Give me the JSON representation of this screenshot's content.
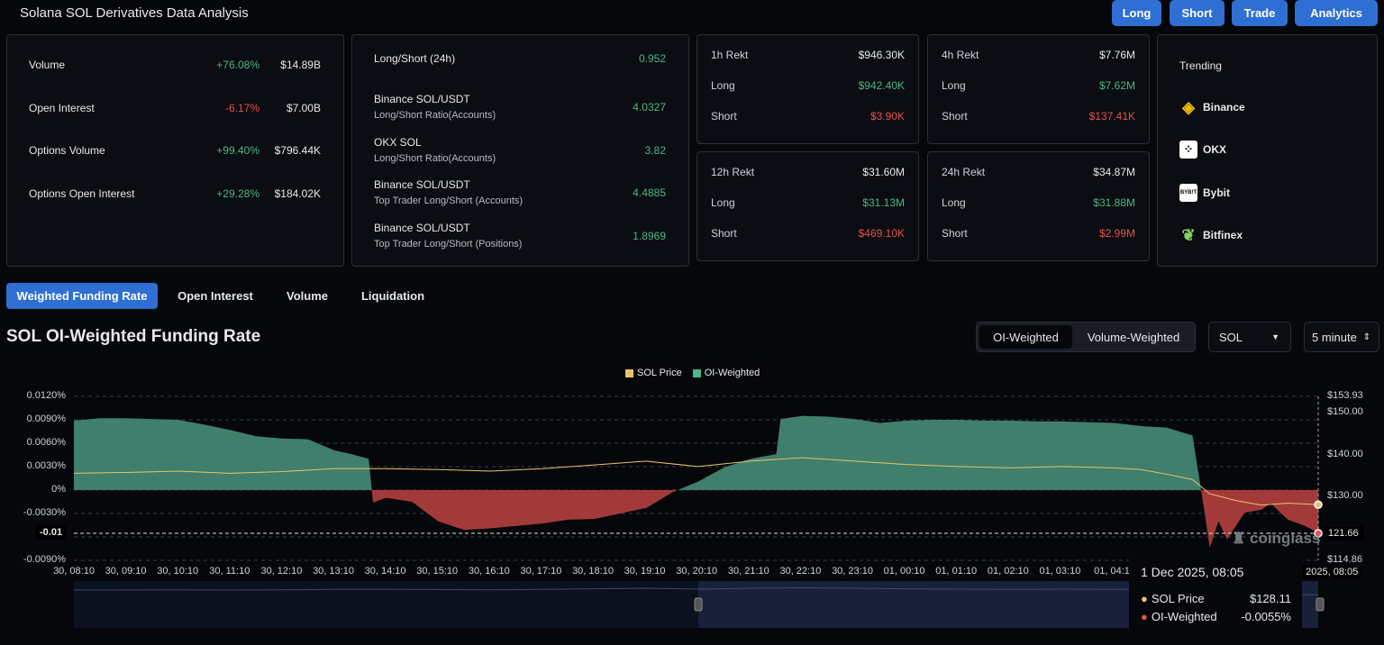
{
  "header": {
    "title": "Solana SOL Derivatives Data Analysis",
    "buttons": [
      "Long",
      "Short",
      "Trade",
      "Analytics"
    ]
  },
  "stats": [
    {
      "label": "Volume",
      "change": "+76.08%",
      "value": "$14.89B",
      "dir": "up"
    },
    {
      "label": "Open Interest",
      "change": "-6.17%",
      "value": "$7.00B",
      "dir": "down"
    },
    {
      "label": "Options Volume",
      "change": "+99.40%",
      "value": "$796.44K",
      "dir": "up"
    },
    {
      "label": "Options Open Interest",
      "change": "+29.28%",
      "value": "$184.02K",
      "dir": "up"
    }
  ],
  "ratios": [
    {
      "label": "Long/Short (24h)",
      "sub": "",
      "value": "0.952"
    },
    {
      "label": "Binance SOL/USDT",
      "sub": "Long/Short Ratio(Accounts)",
      "value": "4.0327"
    },
    {
      "label": "OKX SOL",
      "sub": "Long/Short Ratio(Accounts)",
      "value": "3.82"
    },
    {
      "label": "Binance SOL/USDT",
      "sub": "Top Trader Long/Short (Accounts)",
      "value": "4.4885"
    },
    {
      "label": "Binance SOL/USDT",
      "sub": "Top Trader Long/Short (Positions)",
      "value": "1.8969"
    }
  ],
  "rekt": [
    {
      "label": "1h Rekt",
      "total": "$946.30K",
      "long_label": "Long",
      "long": "$942.40K",
      "short_label": "Short",
      "short": "$3.90K"
    },
    {
      "label": "4h Rekt",
      "total": "$7.76M",
      "long_label": "Long",
      "long": "$7.62M",
      "short_label": "Short",
      "short": "$137.41K"
    },
    {
      "label": "12h Rekt",
      "total": "$31.60M",
      "long_label": "Long",
      "long": "$31.13M",
      "short_label": "Short",
      "short": "$469.10K"
    },
    {
      "label": "24h Rekt",
      "total": "$34.87M",
      "long_label": "Long",
      "long": "$31.88M",
      "short_label": "Short",
      "short": "$2.99M"
    }
  ],
  "trending": {
    "title": "Trending",
    "items": [
      "Binance",
      "OKX",
      "Bybit",
      "Bitfinex"
    ],
    "logo_text_bybit": "BYBIT"
  },
  "tabs": [
    "Weighted Funding Rate",
    "Open Interest",
    "Volume",
    "Liquidation"
  ],
  "chart_header": {
    "title": "SOL OI-Weighted Funding Rate",
    "weight_options": [
      "OI-Weighted",
      "Volume-Weighted"
    ],
    "coin": "SOL",
    "interval": "5 minute"
  },
  "colors": {
    "accent": "#2f6fd4",
    "positive": "#3f7f6b",
    "negative": "#a33a3a",
    "price": "#e8c46a"
  },
  "chart_data": {
    "type": "area",
    "legend": [
      "SOL Price",
      "OI-Weighted"
    ],
    "legend_position": "top",
    "y_left": {
      "ticks": [
        "0.0120%",
        "0.0090%",
        "0.0060%",
        "0.0030%",
        "0%",
        "-0.0030%",
        "-0.",
        "-0.0090%"
      ],
      "range": [
        -0.009,
        0.012
      ]
    },
    "y_right": {
      "ticks": [
        "$153.93",
        "$150.00",
        "$140.00",
        "$130.00",
        "$114.86"
      ],
      "range": [
        114.86,
        153.93
      ]
    },
    "x_ticks": [
      "30, 08:10",
      "30, 09:10",
      "30, 10:10",
      "30, 11:10",
      "30, 12:10",
      "30, 13:10",
      "30, 14:10",
      "30, 15:10",
      "30, 16:10",
      "30, 17:10",
      "30, 18:10",
      "30, 19:10",
      "30, 20:10",
      "30, 21:10",
      "30, 22:10",
      "30, 23:10",
      "01, 00:10",
      "01, 01:10",
      "01, 02:10",
      "01, 03:10",
      "01, 04:1"
    ],
    "crosshair": {
      "left_label": "-0.01",
      "right_label": "121.66",
      "x_label": ": 2025, 08:05"
    },
    "watermark": "coinglass",
    "series": [
      {
        "name": "OI-Weighted",
        "unit": "%",
        "points": [
          [
            "30 08:10",
            0.0089
          ],
          [
            "30 08:40",
            0.0092
          ],
          [
            "30 09:10",
            0.0092
          ],
          [
            "30 10:10",
            0.009
          ],
          [
            "30 10:40",
            0.0084
          ],
          [
            "30 11:10",
            0.0077
          ],
          [
            "30 11:40",
            0.0069
          ],
          [
            "30 12:10",
            0.0066
          ],
          [
            "30 12:40",
            0.0065
          ],
          [
            "30 13:10",
            0.0051
          ],
          [
            "30 13:30",
            0.0046
          ],
          [
            "30 13:50",
            0.004
          ],
          [
            "30 13:55",
            -0.0016
          ],
          [
            "30 14:10",
            -0.001
          ],
          [
            "30 14:40",
            -0.0015
          ],
          [
            "30 15:10",
            -0.004
          ],
          [
            "30 15:40",
            -0.0051
          ],
          [
            "30 16:10",
            -0.0049
          ],
          [
            "30 16:40",
            -0.0046
          ],
          [
            "30 17:10",
            -0.0043
          ],
          [
            "30 17:40",
            -0.0038
          ],
          [
            "30 18:10",
            -0.0037
          ],
          [
            "30 18:40",
            -0.003
          ],
          [
            "30 19:10",
            -0.0023
          ],
          [
            "30 19:40",
            -0.0003
          ],
          [
            "30 20:10",
            0.0011
          ],
          [
            "30 20:40",
            0.0029
          ],
          [
            "30 21:10",
            0.004
          ],
          [
            "30 21:40",
            0.0046
          ],
          [
            "30 21:45",
            0.0091
          ],
          [
            "30 22:10",
            0.0095
          ],
          [
            "30 22:40",
            0.0094
          ],
          [
            "30 23:10",
            0.0091
          ],
          [
            "30 23:40",
            0.0086
          ],
          [
            "01 00:10",
            0.0089
          ],
          [
            "01 00:40",
            0.009
          ],
          [
            "01 01:10",
            0.009
          ],
          [
            "01 01:40",
            0.0089
          ],
          [
            "01 02:10",
            0.0089
          ],
          [
            "01 02:40",
            0.0088
          ],
          [
            "01 03:10",
            0.0088
          ],
          [
            "01 03:40",
            0.0087
          ],
          [
            "01 04:10",
            0.0086
          ],
          [
            "01 04:40",
            0.0082
          ],
          [
            "01 05:10",
            0.008
          ],
          [
            "01 05:40",
            0.007
          ],
          [
            "01 05:50",
            0.0
          ],
          [
            "01 06:00",
            -0.0074
          ],
          [
            "01 06:10",
            -0.004
          ],
          [
            "01 06:20",
            -0.0063
          ],
          [
            "01 06:40",
            -0.0029
          ],
          [
            "01 07:00",
            -0.0025
          ],
          [
            "01 07:10",
            -0.0017
          ],
          [
            "01 07:30",
            -0.0038
          ],
          [
            "01 07:50",
            -0.0046
          ],
          [
            "01 08:05",
            -0.0055
          ]
        ]
      },
      {
        "name": "SOL Price",
        "unit": "$",
        "points": [
          [
            "30 08:10",
            135.6
          ],
          [
            "30 09:10",
            135.8
          ],
          [
            "30 10:10",
            136.1
          ],
          [
            "30 11:10",
            135.6
          ],
          [
            "30 12:10",
            136.0
          ],
          [
            "30 13:10",
            136.7
          ],
          [
            "30 14:10",
            136.7
          ],
          [
            "30 15:10",
            136.5
          ],
          [
            "30 16:10",
            136.1
          ],
          [
            "30 17:10",
            136.7
          ],
          [
            "30 18:10",
            137.6
          ],
          [
            "30 19:10",
            138.5
          ],
          [
            "30 20:10",
            137.2
          ],
          [
            "30 21:10",
            138.5
          ],
          [
            "30 22:10",
            139.3
          ],
          [
            "30 23:10",
            138.5
          ],
          [
            "01 00:10",
            137.7
          ],
          [
            "01 01:10",
            137.2
          ],
          [
            "01 02:10",
            136.9
          ],
          [
            "01 03:10",
            137.2
          ],
          [
            "01 04:10",
            136.9
          ],
          [
            "01 04:40",
            136.5
          ],
          [
            "01 05:10",
            135.4
          ],
          [
            "01 05:40",
            134.1
          ],
          [
            "01 06:00",
            130.7
          ],
          [
            "01 06:30",
            129.1
          ],
          [
            "01 07:00",
            128.0
          ],
          [
            "01 07:30",
            128.5
          ],
          [
            "01 08:05",
            128.11
          ]
        ]
      }
    ]
  },
  "tooltip": {
    "time": "1 Dec 2025, 08:05",
    "rows": [
      {
        "label": "SOL Price",
        "value": "$128.11"
      },
      {
        "label": "OI-Weighted",
        "value": "-0.0055%"
      }
    ]
  }
}
